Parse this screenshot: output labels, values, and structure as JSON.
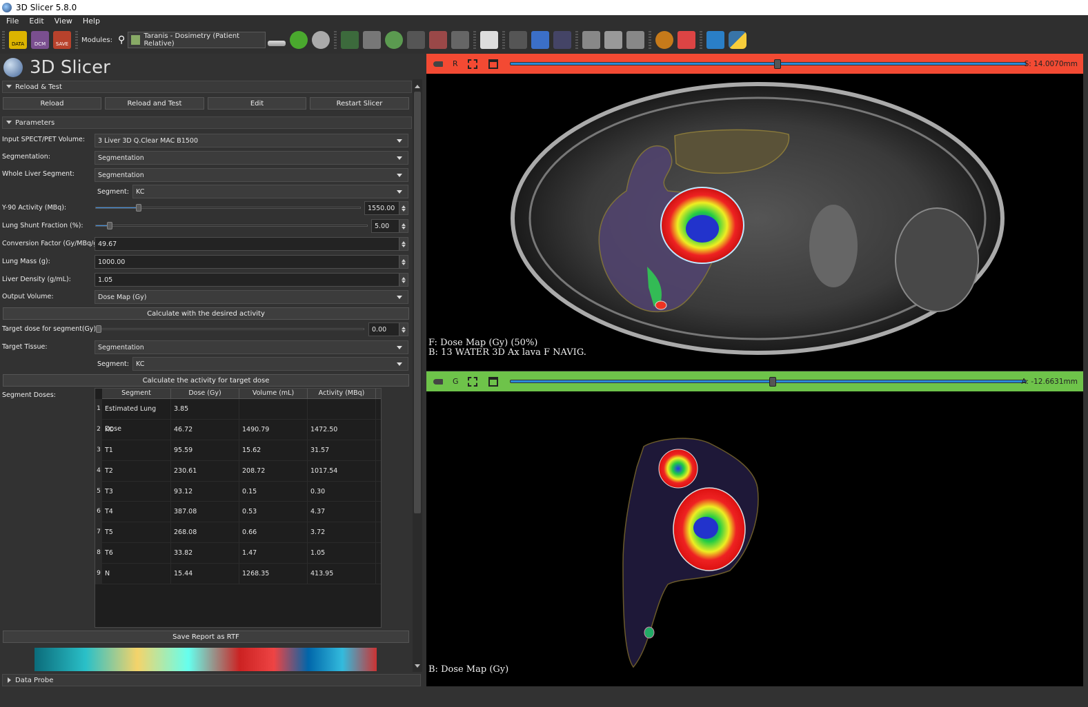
{
  "window": {
    "title": "3D Slicer 5.8.0"
  },
  "menu": [
    "File",
    "Edit",
    "View",
    "Help"
  ],
  "toolbar": {
    "data_label": "DATA",
    "dcm_label": "DCM",
    "save_label": "SAVE",
    "modules_label": "Modules:",
    "module_selected": "Taranis - Dosimetry (Patient Relative)"
  },
  "app": {
    "logo_text": "3D Slicer"
  },
  "reload": {
    "section": "Reload & Test",
    "reload": "Reload",
    "reload_test": "Reload and Test",
    "edit": "Edit",
    "restart": "Restart Slicer"
  },
  "params": {
    "section": "Parameters",
    "input_label": "Input SPECT/PET Volume:",
    "input_value": "3 Liver 3D Q.Clear MAC B1500",
    "seg_label": "Segmentation:",
    "seg_value": "Segmentation",
    "liver_label": "Whole Liver Segment:",
    "liver_value": "Segmentation",
    "segment_label": "Segment:",
    "segment_value": "KC",
    "y90_label": "Y-90 Activity (MBq):",
    "y90_value": "1550.00",
    "y90_fraction": 0.16,
    "shunt_label": "Lung Shunt Fraction (%):",
    "shunt_value": "5.00",
    "shunt_fraction": 0.05,
    "conv_label": "Conversion Factor (Gy/MBq/g):",
    "conv_value": "49.67",
    "lungmass_label": "Lung Mass (g):",
    "lungmass_value": "1000.00",
    "density_label": "Liver Density (g/mL):",
    "density_value": "1.05",
    "output_label": "Output Volume:",
    "output_value": "Dose Map (Gy)",
    "calc_desired": "Calculate with the desired activity",
    "target_label": "Target dose for segment(Gy):",
    "target_value": "0.00",
    "tissue_label": "Target Tissue:",
    "tissue_value": "Segmentation",
    "tissue_segment_label": "Segment:",
    "tissue_segment_value": "KC",
    "calc_target": "Calculate the activity for target dose",
    "doses_label": "Segment Doses:",
    "save_report": "Save Report as RTF"
  },
  "table": {
    "headers": [
      "Segment",
      "Dose (Gy)",
      "Volume (mL)",
      "Activity (MBq)"
    ],
    "rows": [
      {
        "n": "1",
        "seg": "Estimated Lung Dose",
        "dose": "3.85",
        "vol": "",
        "act": ""
      },
      {
        "n": "2",
        "seg": "KC",
        "dose": "46.72",
        "vol": "1490.79",
        "act": "1472.50"
      },
      {
        "n": "3",
        "seg": "T1",
        "dose": "95.59",
        "vol": "15.62",
        "act": "31.57"
      },
      {
        "n": "4",
        "seg": "T2",
        "dose": "230.61",
        "vol": "208.72",
        "act": "1017.54"
      },
      {
        "n": "5",
        "seg": "T3",
        "dose": "93.12",
        "vol": "0.15",
        "act": "0.30"
      },
      {
        "n": "6",
        "seg": "T4",
        "dose": "387.08",
        "vol": "0.53",
        "act": "4.37"
      },
      {
        "n": "7",
        "seg": "T5",
        "dose": "268.08",
        "vol": "0.66",
        "act": "3.72"
      },
      {
        "n": "8",
        "seg": "T6",
        "dose": "33.82",
        "vol": "1.47",
        "act": "1.05"
      },
      {
        "n": "9",
        "seg": "N",
        "dose": "15.44",
        "vol": "1268.35",
        "act": "413.95"
      }
    ]
  },
  "data_probe": "Data Probe",
  "views": {
    "red": {
      "letter": "R",
      "offset": "S: 14.0070mm",
      "slider_fraction": 0.51,
      "fg": "F: Dose Map (Gy)  (50%)",
      "bg": "B: 13 WATER 3D Ax lava F NAVIG.",
      "color": "#f34a33"
    },
    "green": {
      "letter": "G",
      "offset": "A: -12.6631mm",
      "slider_fraction": 0.5,
      "bg": "B: Dose Map (Gy)",
      "color": "#6ec34a"
    }
  }
}
